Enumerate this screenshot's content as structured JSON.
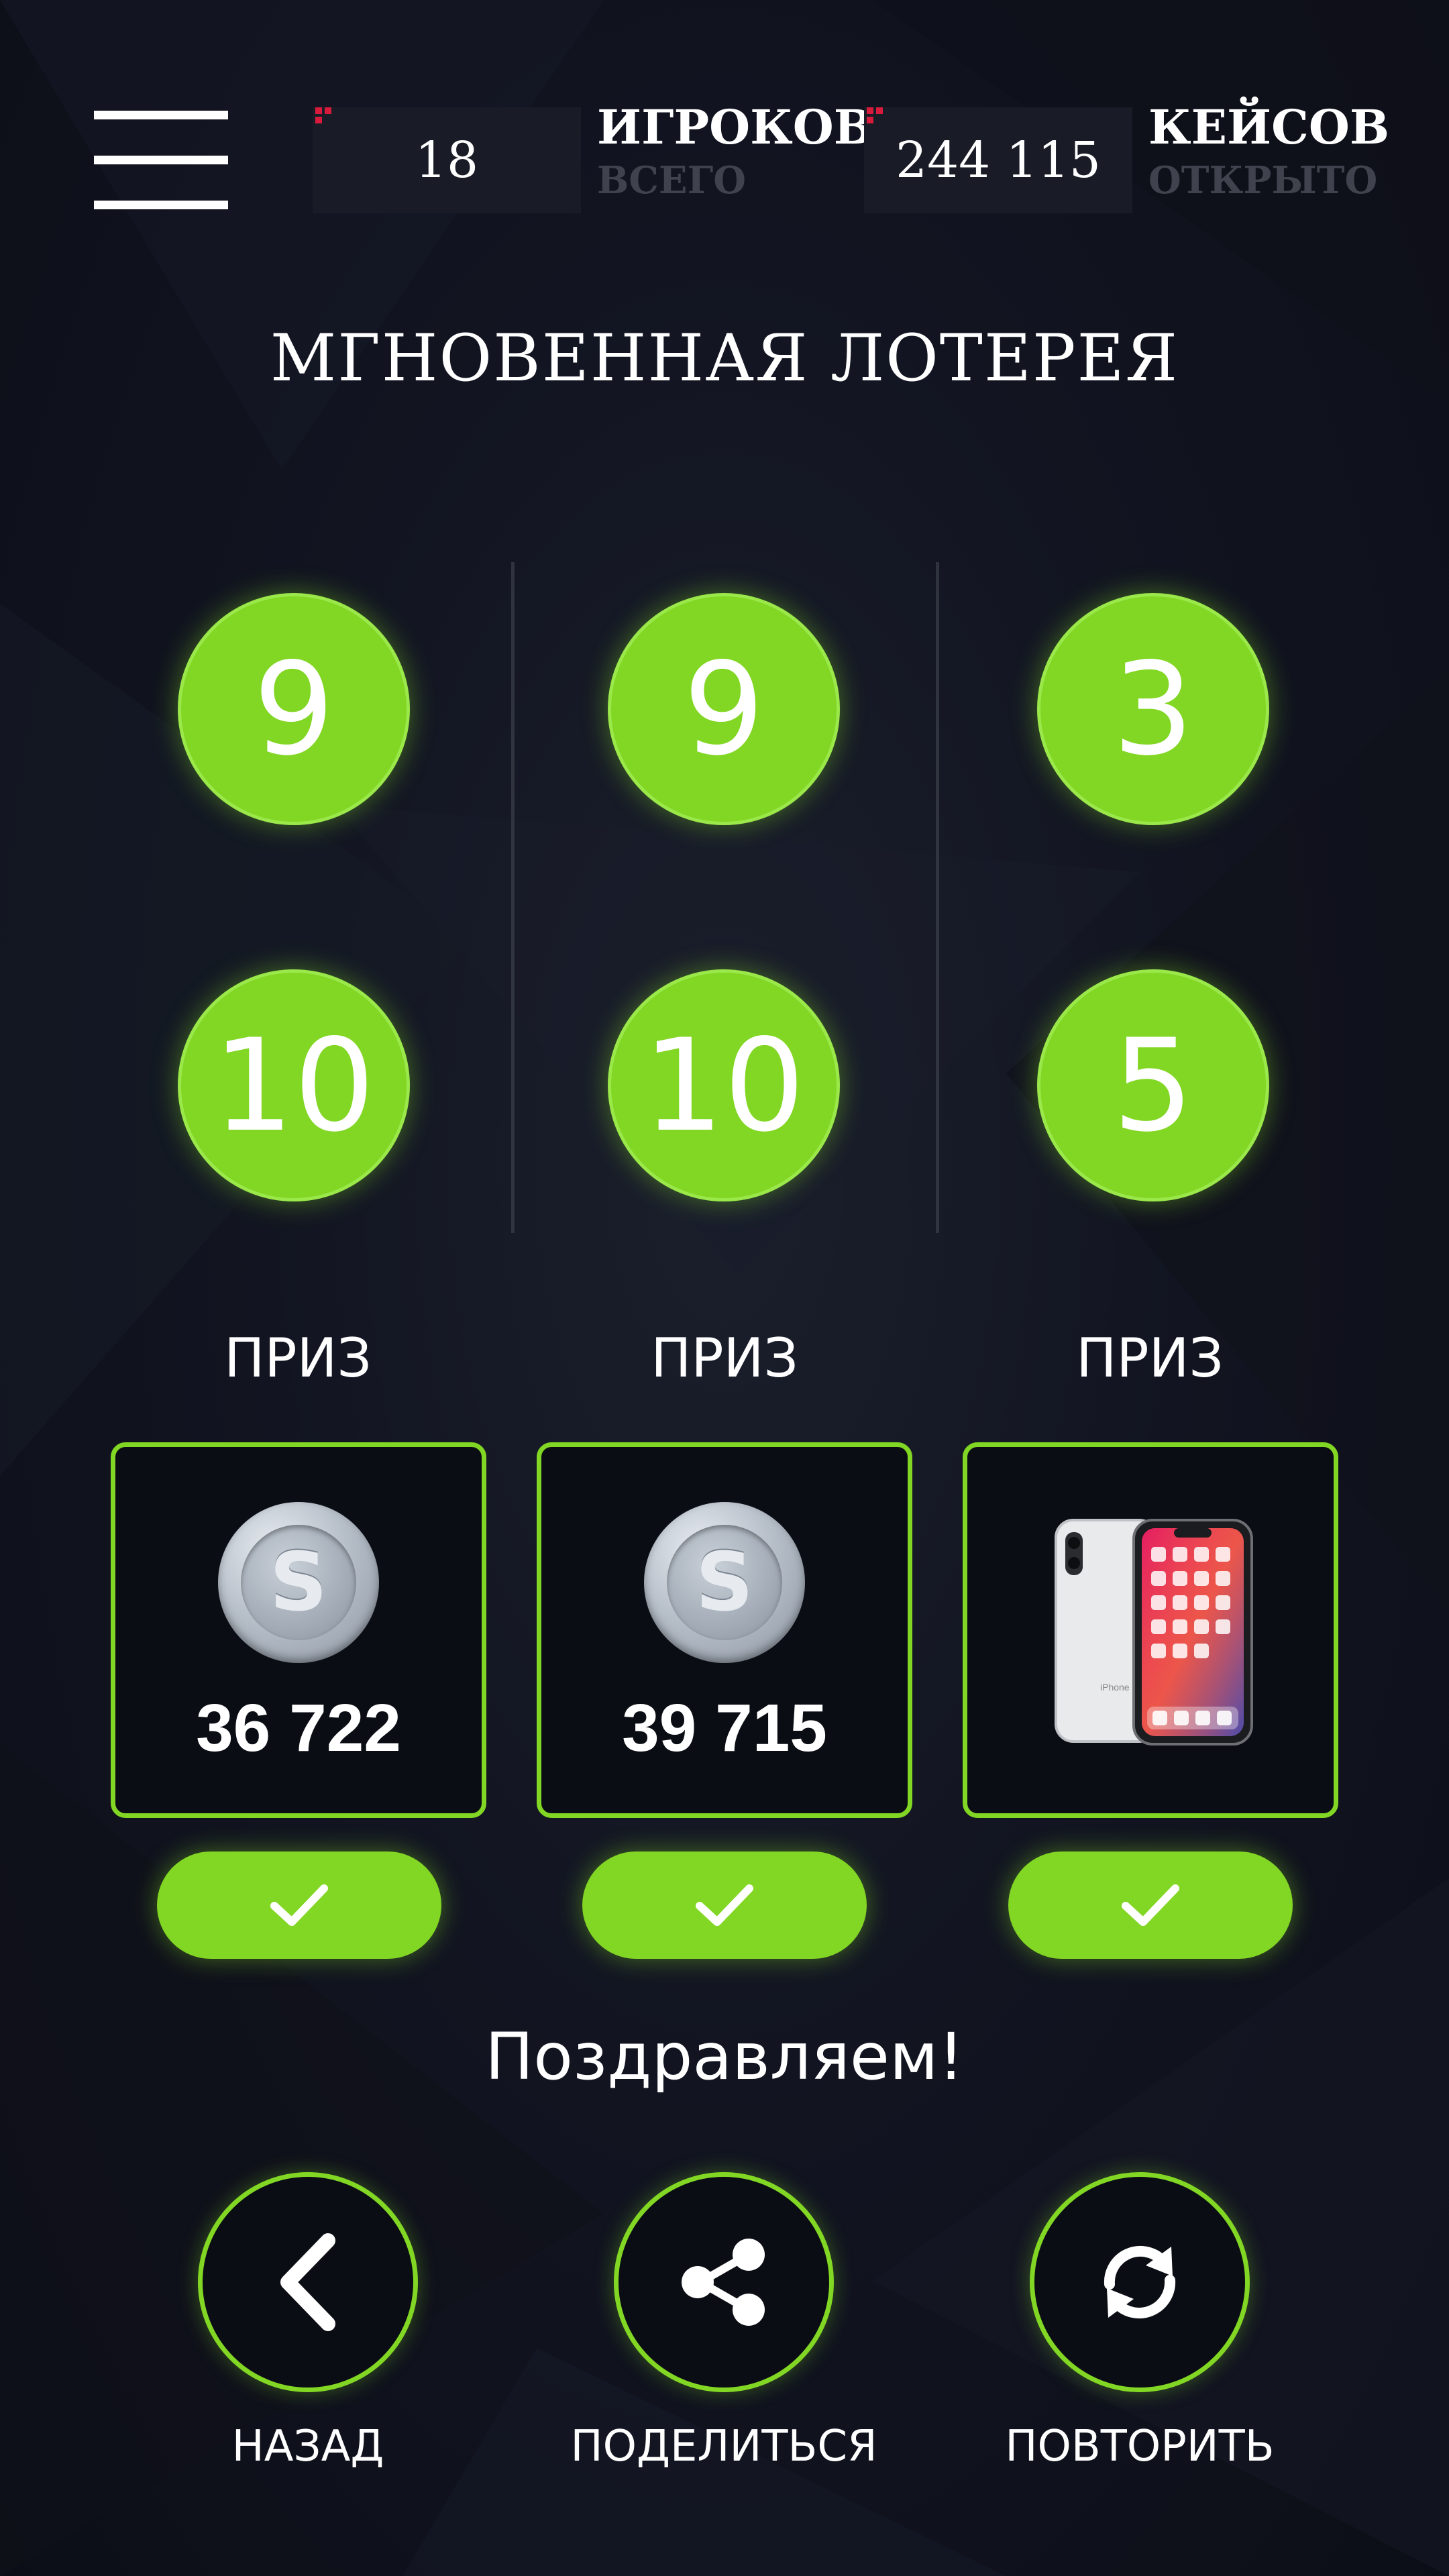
{
  "header": {
    "stats": [
      {
        "value": "18",
        "label_main": "ИГРОКОВ",
        "label_sub": "ВСЕГО"
      },
      {
        "value": "244 115",
        "label_main": "КЕЙСОВ",
        "label_sub": "ОТКРЫТО"
      }
    ]
  },
  "title": "МГНОВЕННАЯ ЛОТЕРЕЯ",
  "columns": [
    {
      "ball_top": "9",
      "ball_bottom": "10",
      "prize_label": "ПРИЗ",
      "prize_type": "coin",
      "prize_icon": "s-coin-icon",
      "prize_amount": "36 722"
    },
    {
      "ball_top": "9",
      "ball_bottom": "10",
      "prize_label": "ПРИЗ",
      "prize_type": "coin",
      "prize_icon": "s-coin-icon",
      "prize_amount": "39 715"
    },
    {
      "ball_top": "3",
      "ball_bottom": "5",
      "prize_label": "ПРИЗ",
      "prize_type": "image",
      "prize_icon": "smartphone-image"
    }
  ],
  "coin_symbol": "S",
  "phone_model_text": "iPhone",
  "message": "Поздравляем!",
  "actions": [
    {
      "icon": "chevron-left-icon",
      "label": "НАЗАД"
    },
    {
      "icon": "share-icon",
      "label": "ПОДЕЛИТЬСЯ"
    },
    {
      "icon": "refresh-icon",
      "label": "ПОВТОРИТЬ"
    }
  ],
  "colors": {
    "accent": "#82d624",
    "background": "#121521",
    "stat_box": "#191c26",
    "corner_marker": "#d81b3c",
    "muted_text": "#40434d"
  }
}
